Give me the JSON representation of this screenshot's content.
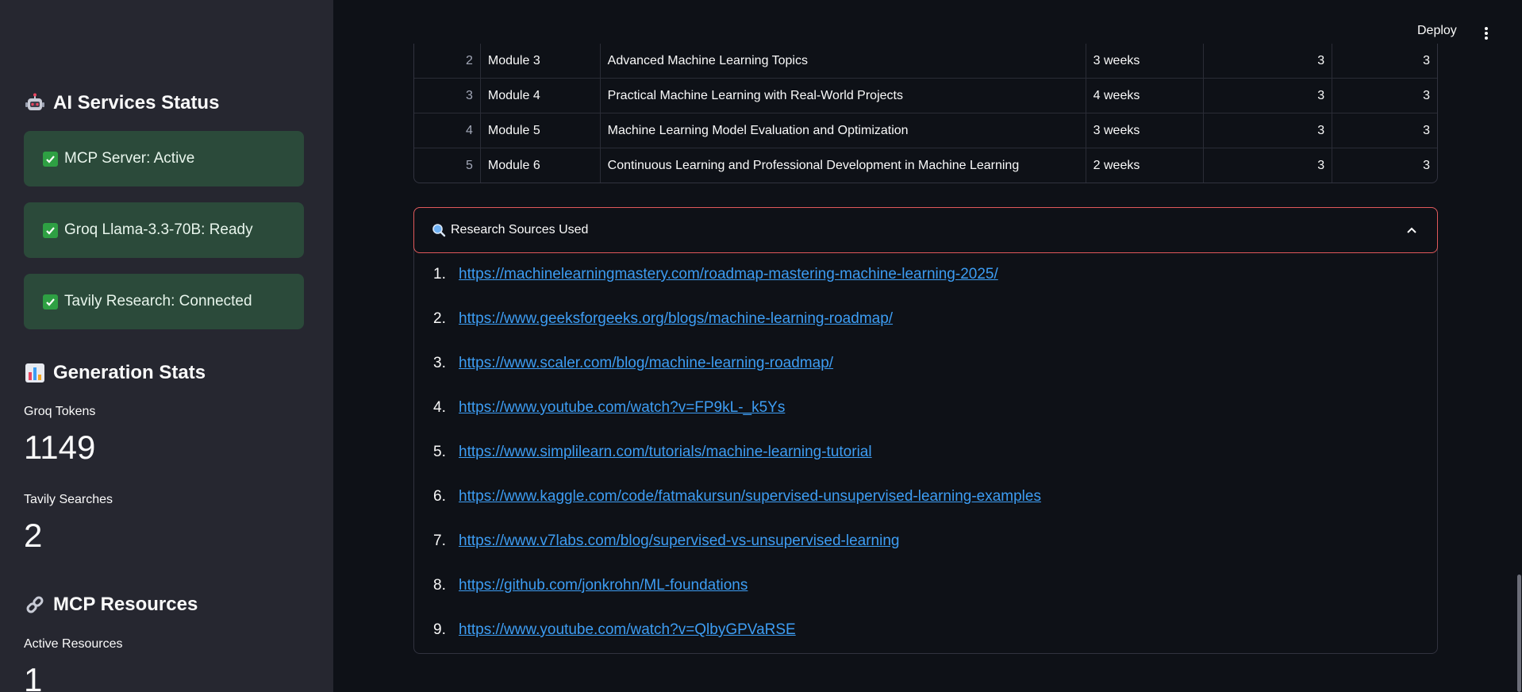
{
  "sidebar": {
    "ai_status": {
      "title": "AI Services Status",
      "icon": "robot-icon",
      "cards": [
        {
          "label": "MCP Server: Active"
        },
        {
          "label": "Groq Llama-3.3-70B: Ready"
        },
        {
          "label": "Tavily Research: Connected"
        }
      ]
    },
    "generation_stats": {
      "title": "Generation Stats",
      "icon": "bar-chart-icon",
      "groq_tokens_label": "Groq Tokens",
      "groq_tokens_value": "1149",
      "tavily_searches_label": "Tavily Searches",
      "tavily_searches_value": "2"
    },
    "mcp_resources": {
      "title": "MCP Resources",
      "icon": "link-icon",
      "active_resources_label": "Active Resources",
      "active_resources_value": "1"
    }
  },
  "header": {
    "deploy_label": "Deploy"
  },
  "table": {
    "rows": [
      {
        "idx": "2",
        "module": "Module 3",
        "title": "Advanced Machine Learning Topics",
        "duration": "3 weeks",
        "n1": "3",
        "n2": "3"
      },
      {
        "idx": "3",
        "module": "Module 4",
        "title": "Practical Machine Learning with Real-World Projects",
        "duration": "4 weeks",
        "n1": "3",
        "n2": "3"
      },
      {
        "idx": "4",
        "module": "Module 5",
        "title": "Machine Learning Model Evaluation and Optimization",
        "duration": "3 weeks",
        "n1": "3",
        "n2": "3"
      },
      {
        "idx": "5",
        "module": "Module 6",
        "title": "Continuous Learning and Professional Development in Machine Learning",
        "duration": "2 weeks",
        "n1": "3",
        "n2": "3"
      }
    ]
  },
  "research": {
    "title": "Research Sources Used",
    "sources": [
      {
        "num": "1.",
        "url": "https://machinelearningmastery.com/roadmap-mastering-machine-learning-2025/"
      },
      {
        "num": "2.",
        "url": "https://www.geeksforgeeks.org/blogs/machine-learning-roadmap/"
      },
      {
        "num": "3.",
        "url": "https://www.scaler.com/blog/machine-learning-roadmap/"
      },
      {
        "num": "4.",
        "url": "https://www.youtube.com/watch?v=FP9kL-_k5Ys"
      },
      {
        "num": "5.",
        "url": "https://www.simplilearn.com/tutorials/machine-learning-tutorial"
      },
      {
        "num": "6.",
        "url": "https://www.kaggle.com/code/fatmakursun/supervised-unsupervised-learning-examples"
      },
      {
        "num": "7.",
        "url": "https://www.v7labs.com/blog/supervised-vs-unsupervised-learning"
      },
      {
        "num": "8.",
        "url": "https://github.com/jonkrohn/ML-foundations"
      },
      {
        "num": "9.",
        "url": "https://www.youtube.com/watch?v=QlbyGPVaRSE"
      }
    ]
  },
  "colors": {
    "sidebar_bg": "#262730",
    "main_bg": "#0e1117",
    "success_card": "#2b4a3a",
    "link": "#3d9df3",
    "expander_border": "#e0585a"
  }
}
